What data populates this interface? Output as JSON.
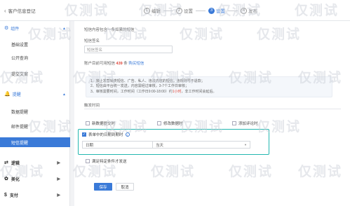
{
  "header": {
    "back_label": "客户信息登记",
    "steps": [
      {
        "num": "1",
        "label": "编辑"
      },
      {
        "num": "2",
        "label": "设置"
      },
      {
        "num": "3",
        "label": "设置"
      },
      {
        "num": "4",
        "label": "发布"
      }
    ]
  },
  "sidebar": {
    "section1": {
      "label": "组件"
    },
    "section1_items": [
      "基础设置",
      "公开查询",
      "提交文案"
    ],
    "section2": {
      "label": "提醒"
    },
    "section2_items": [
      "数据提醒",
      "邮件提醒",
      "短信提醒"
    ],
    "groups": [
      {
        "label": "逻辑"
      },
      {
        "label": "美化"
      },
      {
        "label": "支付"
      }
    ]
  },
  "main": {
    "top_label": "短信内容包含一条如果的短信",
    "name_label": "短信签名",
    "name_placeholder": "短信签名",
    "count_prefix": "账户目前可用短信",
    "count_value": "439",
    "count_suffix": "条",
    "count_link": "购买短信",
    "info_lines": [
      "1、禁止发营销类短信、广告、私人、违法内容的短信，违规则号不退款；",
      "2、短信由平台统一发送，内容需经过审核，3-7个工作日审核；",
      "3、审核需要时间，工作时间（工作日9:00-18:00）约"
    ],
    "info_highlight": "1小时",
    "info_tail": "，非工作时间会延后。",
    "trigger_label": "触发时间",
    "options": {
      "new_data": "新数据提交时",
      "modify_data": "修改数据时",
      "add_comment": "添加评论时",
      "date_field": "表单中的日期到期时",
      "condition": "满足特定条件才发送"
    },
    "date_select": "日期",
    "day_select": "当天",
    "save_label": "保存",
    "cancel_label": "取消"
  },
  "watermark": "仅测试"
}
